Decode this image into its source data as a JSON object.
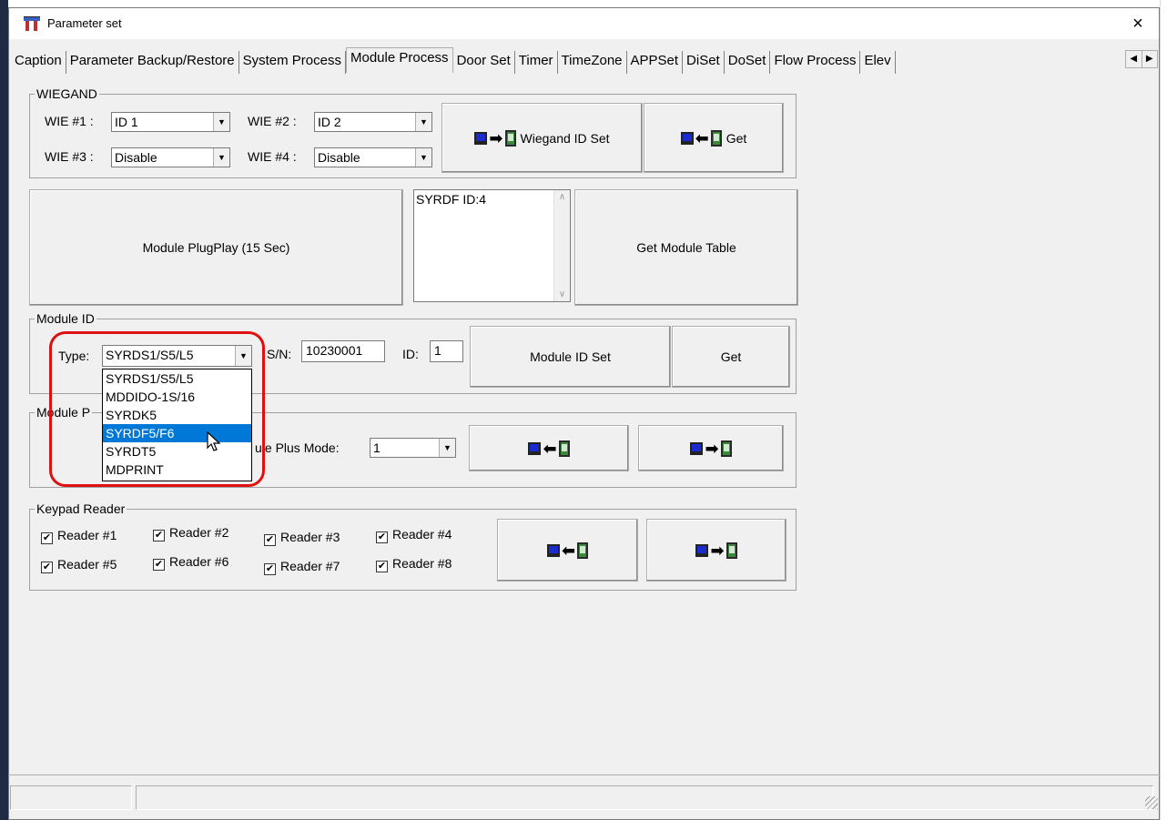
{
  "window": {
    "title": "Parameter set",
    "close_label": "×"
  },
  "tabs": [
    {
      "label": "Caption"
    },
    {
      "label": "Parameter Backup/Restore"
    },
    {
      "label": "System Process"
    },
    {
      "label": "Module Process"
    },
    {
      "label": "Door Set"
    },
    {
      "label": "Timer"
    },
    {
      "label": "TimeZone"
    },
    {
      "label": "APPSet"
    },
    {
      "label": "DiSet"
    },
    {
      "label": "DoSet"
    },
    {
      "label": "Flow Process"
    },
    {
      "label": "Elev"
    }
  ],
  "tab_scroll": {
    "left": "◀",
    "right": "▶"
  },
  "wiegand": {
    "group_label": "WIEGAND",
    "wie1_label": "WIE #1 :",
    "wie1_value": "ID 1",
    "wie2_label": "WIE #2 :",
    "wie2_value": "ID 2",
    "wie3_label": "WIE #3 :",
    "wie3_value": "Disable",
    "wie4_label": "WIE #4 :",
    "wie4_value": "Disable",
    "set_button": "Wiegand ID Set",
    "get_button": "Get"
  },
  "plugplay": {
    "plugplay_button": "Module PlugPlay (15 Sec)",
    "list_items": [
      "SYRDF ID:4"
    ],
    "get_table_button": "Get Module Table"
  },
  "module_id": {
    "group_label": "Module ID",
    "type_label": "Type:",
    "type_value": "SYRDS1/S5/L5",
    "sn_label": "S/N:",
    "sn_value": "10230001",
    "id_label": "ID:",
    "id_value": "1",
    "set_button": "Module ID Set",
    "get_button": "Get"
  },
  "type_dropdown": {
    "options": [
      "SYRDS1/S5/L5",
      "MDDIDO-1S/16",
      "SYRDK5",
      "SYRDF5/F6",
      "SYRDT5",
      "MDPRINT"
    ],
    "selected_index": 3
  },
  "module_plus": {
    "group_label": "Module P",
    "mode_label": "ule Plus Mode:",
    "mode_value": "1"
  },
  "keypad": {
    "group_label": "Keypad Reader",
    "readers": [
      {
        "label": "Reader #1",
        "checked": true
      },
      {
        "label": "Reader #2",
        "checked": true
      },
      {
        "label": "Reader #3",
        "checked": true
      },
      {
        "label": "Reader #4",
        "checked": true
      },
      {
        "label": "Reader #5",
        "checked": true
      },
      {
        "label": "Reader #6",
        "checked": true
      },
      {
        "label": "Reader #7",
        "checked": true
      },
      {
        "label": "Reader #8",
        "checked": true
      }
    ]
  },
  "colors": {
    "highlight": "#e01010",
    "selection": "#0078d7",
    "pc_icon": "#1a2bd0",
    "device_icon": "#3b8a3b"
  }
}
